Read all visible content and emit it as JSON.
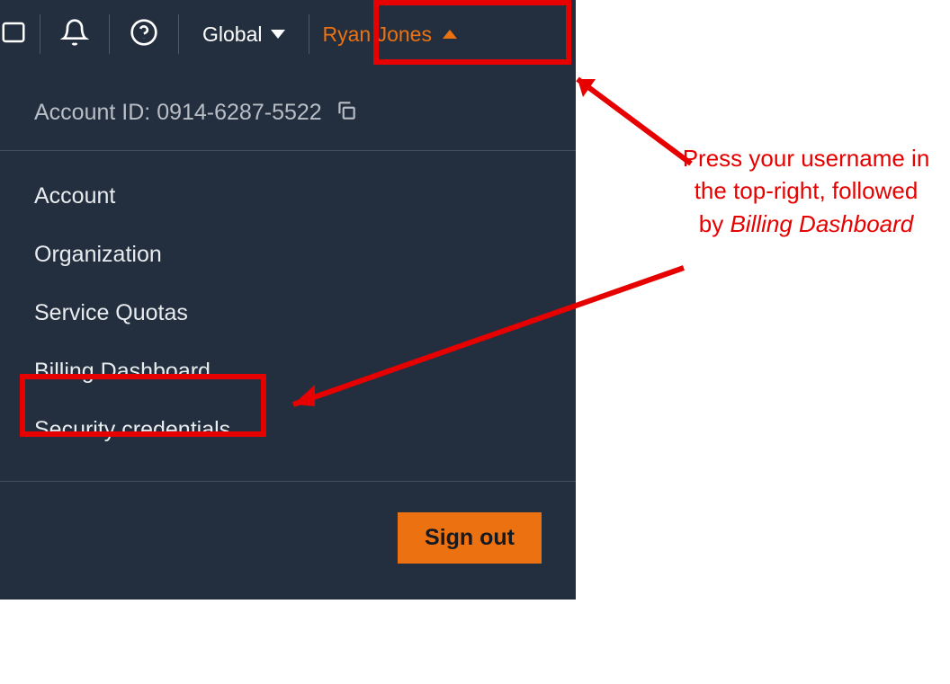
{
  "topbar": {
    "region_label": "Global",
    "user_name": "Ryan Jones"
  },
  "account": {
    "label_prefix": "Account ID:",
    "id": "0914-6287-5522"
  },
  "menu": {
    "items": [
      "Account",
      "Organization",
      "Service Quotas",
      "Billing Dashboard",
      "Security credentials"
    ]
  },
  "footer": {
    "signout_label": "Sign out"
  },
  "annotation": {
    "line1": "Press your username in the top-right, followed by",
    "line2_italic": "Billing Dashboard"
  }
}
